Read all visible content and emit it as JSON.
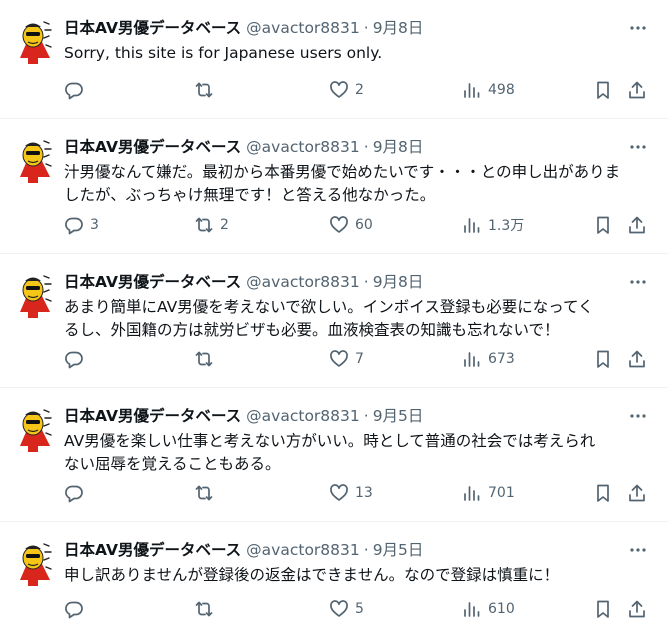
{
  "account": {
    "display_name": "日本AV男優データベース",
    "handle": "@avactor8831",
    "avatar_icon": "cartoon-mascot-avatar"
  },
  "separator": "·",
  "tweets": [
    {
      "date": "9月8日",
      "lines": [
        "Sorry, this site is for Japanese users only."
      ],
      "replies": "",
      "reposts": "",
      "likes": "2",
      "views": "498"
    },
    {
      "date": "9月8日",
      "lines": [
        "汁男優なんて嫌だ。最初から本番男優で始めたいです・・・との申し出がありま",
        "したが、ぶっちゃけ無理です！と答える他なかった。"
      ],
      "replies": "3",
      "reposts": "2",
      "likes": "60",
      "views": "1.3万"
    },
    {
      "date": "9月8日",
      "lines": [
        "あまり簡単にAV男優を考えないで欲しい。インボイス登録も必要になってく",
        "るし、外国籍の方は就労ビザも必要。血液検査表の知識も忘れないで！"
      ],
      "replies": "",
      "reposts": "",
      "likes": "7",
      "views": "673"
    },
    {
      "date": "9月5日",
      "lines": [
        "AV男優を楽しい仕事と考えない方がいい。時として普通の社会では考えられ",
        "ない屈辱を覚えることもある。"
      ],
      "replies": "",
      "reposts": "",
      "likes": "13",
      "views": "701"
    },
    {
      "date": "9月5日",
      "lines": [
        "申し訳ありませんが登録後の返金はできません。なので登録は慎重に！"
      ],
      "replies": "",
      "reposts": "",
      "likes": "5",
      "views": "610"
    }
  ],
  "icons": {
    "reply": "reply-icon",
    "repost": "repost-icon",
    "like": "heart-icon",
    "views": "views-chart-icon",
    "bookmark": "bookmark-icon",
    "share": "share-icon",
    "more": "more-dots-icon"
  },
  "colors": {
    "text": "#0f1419",
    "secondary": "#536471",
    "divider": "#eff3f4",
    "avatar_red": "#d9261c",
    "avatar_yellow": "#f5c518"
  }
}
